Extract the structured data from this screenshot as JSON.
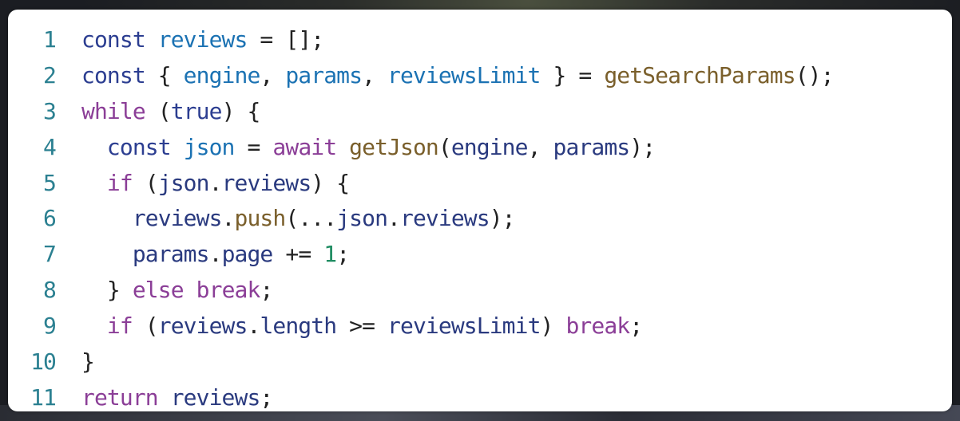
{
  "colors": {
    "declaration_keyword": "#2c3e91",
    "variable": "#1b72b3",
    "function": "#7a5f2b",
    "control_keyword": "#8b3e97",
    "number": "#1f8c62",
    "identifier": "#2a3a7f",
    "line_number": "#2b8091",
    "punctuation": "#222222",
    "card_background": "#ffffff"
  },
  "code": {
    "language": "javascript",
    "lines": [
      {
        "number": "1",
        "tokens": [
          {
            "t": "const",
            "k": "kw-decl"
          },
          {
            "t": " ",
            "k": "punc"
          },
          {
            "t": "reviews",
            "k": "var"
          },
          {
            "t": " = [];",
            "k": "punc"
          }
        ]
      },
      {
        "number": "2",
        "tokens": [
          {
            "t": "const",
            "k": "kw-decl"
          },
          {
            "t": " { ",
            "k": "punc"
          },
          {
            "t": "engine",
            "k": "var"
          },
          {
            "t": ", ",
            "k": "punc"
          },
          {
            "t": "params",
            "k": "var"
          },
          {
            "t": ", ",
            "k": "punc"
          },
          {
            "t": "reviewsLimit",
            "k": "var"
          },
          {
            "t": " } = ",
            "k": "punc"
          },
          {
            "t": "getSearchParams",
            "k": "fn"
          },
          {
            "t": "();",
            "k": "punc"
          }
        ]
      },
      {
        "number": "3",
        "tokens": [
          {
            "t": "while",
            "k": "kw-ctrl"
          },
          {
            "t": " (",
            "k": "punc"
          },
          {
            "t": "true",
            "k": "kw-decl"
          },
          {
            "t": ") {",
            "k": "punc"
          }
        ]
      },
      {
        "number": "4",
        "tokens": [
          {
            "t": "  ",
            "k": "punc"
          },
          {
            "t": "const",
            "k": "kw-decl"
          },
          {
            "t": " ",
            "k": "punc"
          },
          {
            "t": "json",
            "k": "var"
          },
          {
            "t": " = ",
            "k": "punc"
          },
          {
            "t": "await",
            "k": "kw-ctrl"
          },
          {
            "t": " ",
            "k": "punc"
          },
          {
            "t": "getJson",
            "k": "fn"
          },
          {
            "t": "(",
            "k": "punc"
          },
          {
            "t": "engine",
            "k": "ident"
          },
          {
            "t": ", ",
            "k": "punc"
          },
          {
            "t": "params",
            "k": "ident"
          },
          {
            "t": ");",
            "k": "punc"
          }
        ]
      },
      {
        "number": "5",
        "tokens": [
          {
            "t": "  ",
            "k": "punc"
          },
          {
            "t": "if",
            "k": "kw-ctrl"
          },
          {
            "t": " (",
            "k": "punc"
          },
          {
            "t": "json",
            "k": "ident"
          },
          {
            "t": ".",
            "k": "punc"
          },
          {
            "t": "reviews",
            "k": "ident"
          },
          {
            "t": ") {",
            "k": "punc"
          }
        ]
      },
      {
        "number": "6",
        "tokens": [
          {
            "t": "    ",
            "k": "punc"
          },
          {
            "t": "reviews",
            "k": "ident"
          },
          {
            "t": ".",
            "k": "punc"
          },
          {
            "t": "push",
            "k": "fn"
          },
          {
            "t": "(...",
            "k": "punc"
          },
          {
            "t": "json",
            "k": "ident"
          },
          {
            "t": ".",
            "k": "punc"
          },
          {
            "t": "reviews",
            "k": "ident"
          },
          {
            "t": ");",
            "k": "punc"
          }
        ]
      },
      {
        "number": "7",
        "tokens": [
          {
            "t": "    ",
            "k": "punc"
          },
          {
            "t": "params",
            "k": "ident"
          },
          {
            "t": ".",
            "k": "punc"
          },
          {
            "t": "page",
            "k": "ident"
          },
          {
            "t": " += ",
            "k": "punc"
          },
          {
            "t": "1",
            "k": "num"
          },
          {
            "t": ";",
            "k": "punc"
          }
        ]
      },
      {
        "number": "8",
        "tokens": [
          {
            "t": "  } ",
            "k": "punc"
          },
          {
            "t": "else",
            "k": "kw-ctrl"
          },
          {
            "t": " ",
            "k": "punc"
          },
          {
            "t": "break",
            "k": "kw-ctrl"
          },
          {
            "t": ";",
            "k": "punc"
          }
        ]
      },
      {
        "number": "9",
        "tokens": [
          {
            "t": "  ",
            "k": "punc"
          },
          {
            "t": "if",
            "k": "kw-ctrl"
          },
          {
            "t": " (",
            "k": "punc"
          },
          {
            "t": "reviews",
            "k": "ident"
          },
          {
            "t": ".",
            "k": "punc"
          },
          {
            "t": "length",
            "k": "ident"
          },
          {
            "t": " >= ",
            "k": "punc"
          },
          {
            "t": "reviewsLimit",
            "k": "ident"
          },
          {
            "t": ") ",
            "k": "punc"
          },
          {
            "t": "break",
            "k": "kw-ctrl"
          },
          {
            "t": ";",
            "k": "punc"
          }
        ]
      },
      {
        "number": "10",
        "tokens": [
          {
            "t": "}",
            "k": "punc"
          }
        ]
      },
      {
        "number": "11",
        "tokens": [
          {
            "t": "return",
            "k": "kw-ctrl"
          },
          {
            "t": " ",
            "k": "punc"
          },
          {
            "t": "reviews",
            "k": "ident"
          },
          {
            "t": ";",
            "k": "punc"
          }
        ]
      }
    ]
  }
}
